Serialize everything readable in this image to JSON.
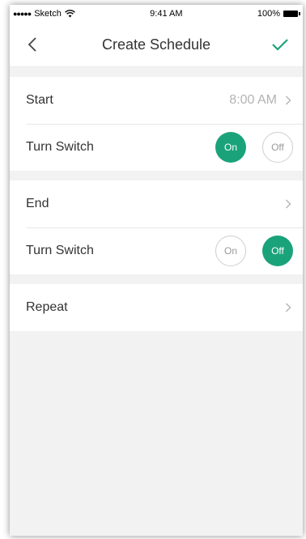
{
  "statusbar": {
    "carrier": "Sketch",
    "time": "9:41 AM",
    "battery": "100%"
  },
  "header": {
    "title": "Create Schedule",
    "back_icon": "chevron-left-icon",
    "confirm_icon": "check-icon",
    "accent": "#1aa37a"
  },
  "start": {
    "label": "Start",
    "value": "8:00 AM"
  },
  "start_switch": {
    "label": "Turn Switch",
    "on": "On",
    "off": "Off",
    "selected": "On"
  },
  "end": {
    "label": "End",
    "value": ""
  },
  "end_switch": {
    "label": "Turn Switch",
    "on": "On",
    "off": "Off",
    "selected": "Off"
  },
  "repeat": {
    "label": "Repeat"
  }
}
